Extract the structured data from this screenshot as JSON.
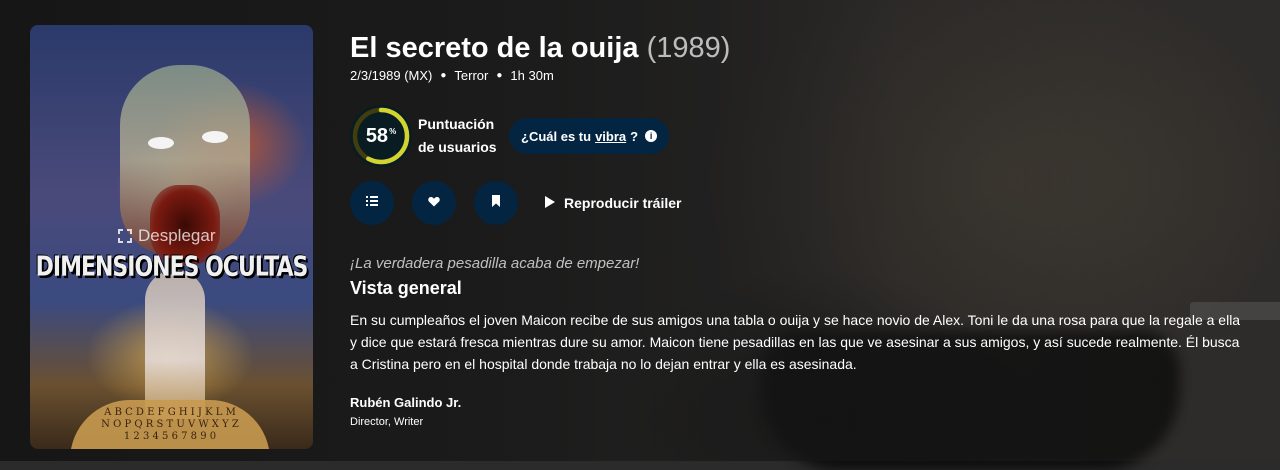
{
  "poster": {
    "title_art": "DIMENSIONES OCULTAS",
    "board_letters_1": "A B C D E F G H I J K L M",
    "board_letters_2": "N O P Q R S T U V W X Y Z",
    "board_numbers": "1 2 3 4 5 6 7 8 9 0",
    "expand_label": "Desplegar"
  },
  "movie": {
    "title": "El secreto de la ouija",
    "year": "(1989)",
    "release": "2/3/1989 (MX)",
    "genre": "Terror",
    "runtime": "1h 30m"
  },
  "score": {
    "value": "58",
    "unit": "%",
    "percent": 58,
    "ring_color": "#d2d531",
    "track_color": "#423d0f",
    "label": "Puntuación de usuarios"
  },
  "vibe": {
    "prefix": "¿Cuál es tu",
    "link": "vibra",
    "suffix": "?",
    "info_glyph": "i"
  },
  "actions": {
    "list_icon": "list-icon",
    "favorite_icon": "heart-icon",
    "watchlist_icon": "bookmark-icon",
    "trailer_label": "Reproducir tráiler"
  },
  "tagline": "¡La verdadera pesadilla acaba de empezar!",
  "overview": {
    "heading": "Vista general",
    "text": "En su cumpleaños el joven Maicon recibe de sus amigos una tabla o ouija y se hace novio de Alex. Toni le da una rosa para que la regale a ella y dice que estará fresca mientras dure su amor. Maicon tiene pesadillas en las que ve asesinar a sus amigos, y así sucede realmente. Él busca a Cristina pero en el hospital donde trabaja no lo dejan entrar y ella es asesinada."
  },
  "crew": [
    {
      "name": "Rubén Galindo Jr.",
      "role": "Director, Writer"
    }
  ],
  "colors": {
    "accent_button": "#032541"
  }
}
